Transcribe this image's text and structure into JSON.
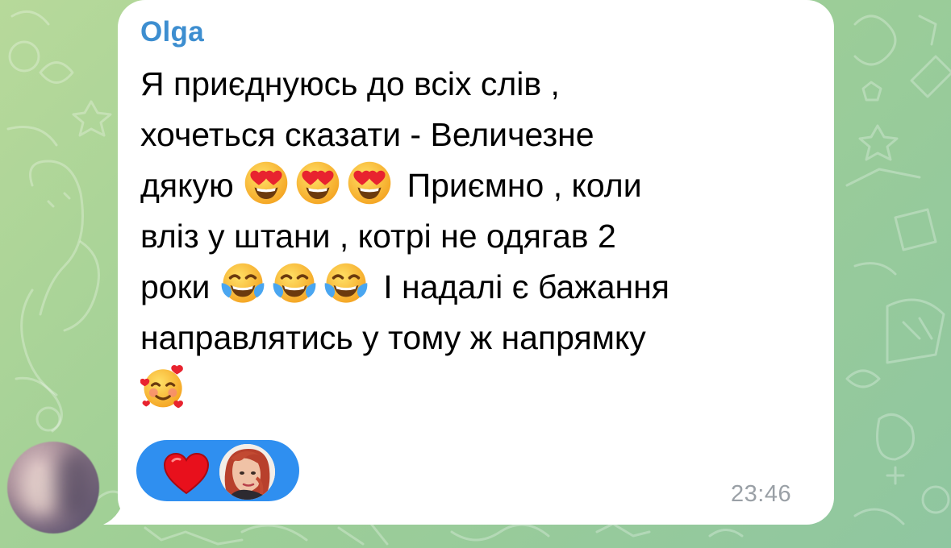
{
  "chat": {
    "background_color": "#a6d199",
    "message": {
      "sender_name": "Olga",
      "sender_color": "#3d8ed0",
      "segments": {
        "l1": "Я приєднуюсь до всіх слів ,",
        "l2": "хочеться сказати - Величезне",
        "l3a": "дякую",
        "l3b": "Приємно , коли",
        "l4": "вліз у штани , котрі не одягав 2",
        "l5a": "роки",
        "l5b": "І надалі є бажання",
        "l6": "направлятись у тому ж напрямку"
      },
      "emoji": {
        "heart_eyes": "heart-eyes-face-icon",
        "tears_of_joy": "face-with-tears-of-joy-icon",
        "smiling_hearts": "smiling-face-with-hearts-icon"
      },
      "time": "23:46"
    },
    "reactions": {
      "pill_color": "#2f8ff0",
      "items": [
        {
          "emoji": "red-heart-icon",
          "reactor": "reactor-avatar"
        }
      ]
    }
  }
}
